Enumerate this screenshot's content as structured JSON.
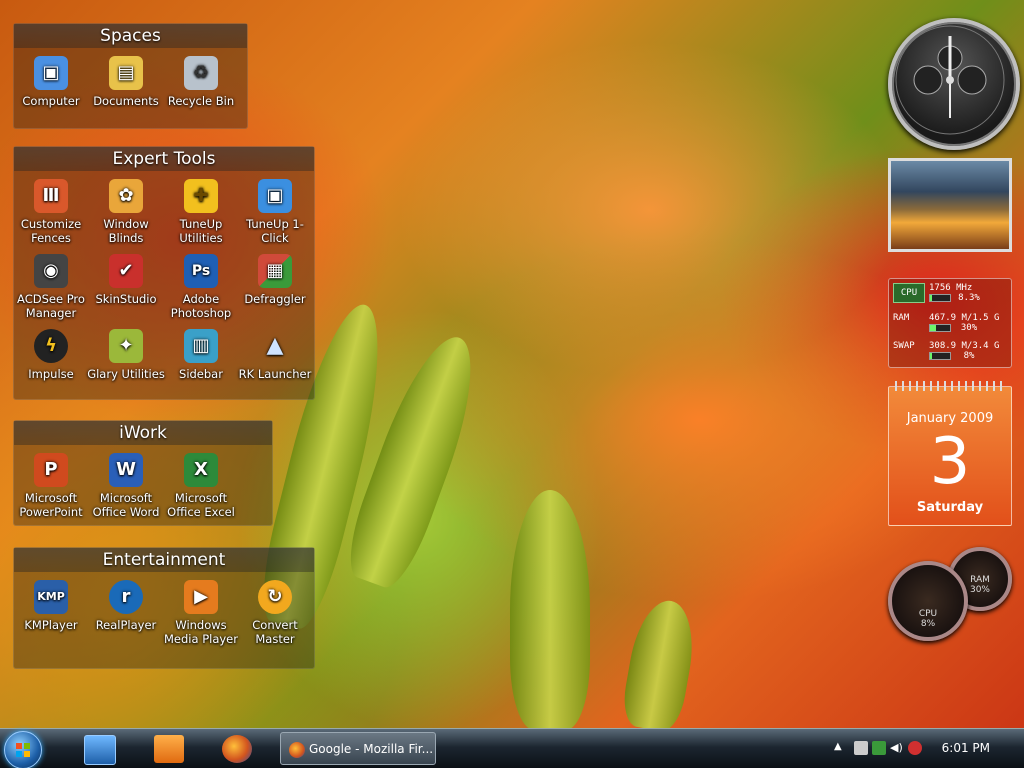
{
  "desktop": {
    "fences": [
      {
        "title": "Spaces",
        "icons": [
          {
            "label": "Computer",
            "icon": "computer-icon",
            "color": "#4a90e2"
          },
          {
            "label": "Documents",
            "icon": "documents-folder-icon",
            "color": "#e8c24a"
          },
          {
            "label": "Recycle Bin",
            "icon": "recycle-bin-icon",
            "color": "#b8c2cc"
          }
        ]
      },
      {
        "title": "Expert Tools",
        "icons": [
          {
            "label": "Customize Fences",
            "icon": "fences-icon",
            "color": "#d9582b"
          },
          {
            "label": "Window Blinds",
            "icon": "windowblinds-icon",
            "color": "#e9a63a"
          },
          {
            "label": "TuneUp Utilities",
            "icon": "tuneup-utilities-icon",
            "color": "#f2c01e"
          },
          {
            "label": "TuneUp 1-Click",
            "icon": "tuneup-1click-icon",
            "color": "#3b8fe0"
          },
          {
            "label": "ACDSee Pro Manager",
            "icon": "acdsee-camera-icon",
            "color": "#444444"
          },
          {
            "label": "SkinStudio",
            "icon": "skinstudio-icon",
            "color": "#c9302c"
          },
          {
            "label": "Adobe Photoshop",
            "icon": "photoshop-icon",
            "color": "#1f5fb4"
          },
          {
            "label": "Defraggler",
            "icon": "defraggler-icon",
            "color": "#d04a3a"
          },
          {
            "label": "Impulse",
            "icon": "impulse-icon",
            "color": "#222222"
          },
          {
            "label": "Glary Utilities",
            "icon": "glary-utilities-icon",
            "color": "#9bb83a"
          },
          {
            "label": "Sidebar",
            "icon": "sidebar-icon",
            "color": "#3aa0c8"
          },
          {
            "label": "RK Launcher",
            "icon": "rocket-icon",
            "color": "#5a7fc8"
          }
        ]
      },
      {
        "title": "iWork",
        "icons": [
          {
            "label": "Microsoft PowerPoint",
            "icon": "powerpoint-icon",
            "color": "#d04a1e"
          },
          {
            "label": "Microsoft Office Word",
            "icon": "word-icon",
            "color": "#2a5fb8"
          },
          {
            "label": "Microsoft Office Excel",
            "icon": "excel-icon",
            "color": "#2d8a3a"
          }
        ]
      },
      {
        "title": "Entertainment",
        "icons": [
          {
            "label": "KMPlayer",
            "icon": "kmplayer-icon",
            "color": "#2a5fa8"
          },
          {
            "label": "RealPlayer",
            "icon": "realplayer-icon",
            "color": "#1a6ab8"
          },
          {
            "label": "Windows Media Player",
            "icon": "wmp-icon",
            "color": "#e57b1e"
          },
          {
            "label": "Convert Master",
            "icon": "convert-master-icon",
            "color": "#f2a81e"
          }
        ]
      }
    ]
  },
  "gadgets": {
    "sysmon": {
      "cpu_label": "CPU",
      "cpu_value": "1756 MHz",
      "cpu_percent": "8.3%",
      "cpu_fraction": 0.083,
      "ram_label": "RAM",
      "ram_value": "467.9 M/1.5 G",
      "ram_percent": "30%",
      "ram_fraction": 0.3,
      "swap_label": "SWAP",
      "swap_value": "308.9 M/3.4 G",
      "swap_percent": "8%",
      "swap_fraction": 0.08
    },
    "calendar": {
      "month_year": "January 2009",
      "day": "3",
      "weekday": "Saturday"
    },
    "meters": {
      "cpu_label": "CPU",
      "cpu_percent": "8%",
      "ram_label": "RAM",
      "ram_percent": "30%"
    }
  },
  "taskbar": {
    "task_title": "Google - Mozilla Fir...",
    "clock": "6:01 PM",
    "colors": {
      "accent": "#3a9eea"
    }
  }
}
